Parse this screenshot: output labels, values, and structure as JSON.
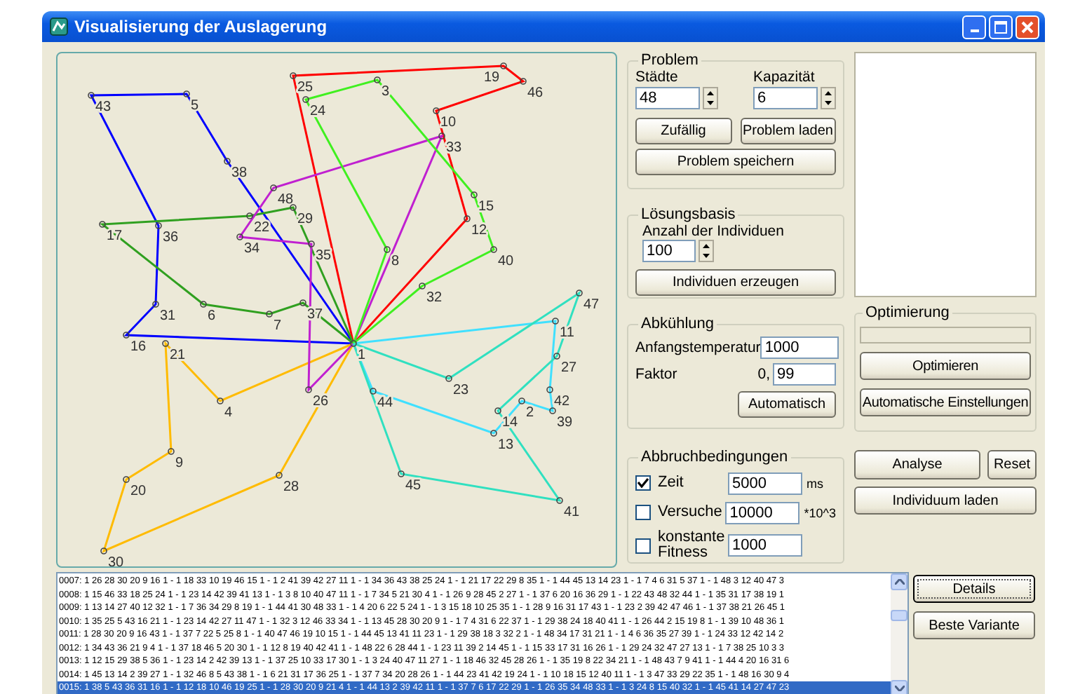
{
  "window": {
    "title": "Visualisierung der Auslagerung"
  },
  "map": {
    "cities": [
      {
        "label": "25"
      },
      {
        "label": "3"
      },
      {
        "label": "19"
      },
      {
        "label": "46"
      },
      {
        "label": "43"
      },
      {
        "label": "5"
      },
      {
        "label": "24"
      },
      {
        "label": "10"
      },
      {
        "label": "33"
      },
      {
        "label": "38"
      },
      {
        "label": "48"
      },
      {
        "label": "15"
      },
      {
        "label": "17"
      },
      {
        "label": "36"
      },
      {
        "label": "22"
      },
      {
        "label": "29"
      },
      {
        "label": "12"
      },
      {
        "label": "34"
      },
      {
        "label": "35"
      },
      {
        "label": "8"
      },
      {
        "label": "40"
      },
      {
        "label": "32"
      },
      {
        "label": "47"
      },
      {
        "label": "31"
      },
      {
        "label": "6"
      },
      {
        "label": "7"
      },
      {
        "label": "37"
      },
      {
        "label": "11"
      },
      {
        "label": "16"
      },
      {
        "label": "21"
      },
      {
        "label": "1"
      },
      {
        "label": "27"
      },
      {
        "label": "4"
      },
      {
        "label": "26"
      },
      {
        "label": "44"
      },
      {
        "label": "23"
      },
      {
        "label": "2"
      },
      {
        "label": "42"
      },
      {
        "label": "14"
      },
      {
        "label": "39"
      },
      {
        "label": "13"
      },
      {
        "label": "9"
      },
      {
        "label": "20"
      },
      {
        "label": "28"
      },
      {
        "label": "45"
      },
      {
        "label": "41"
      },
      {
        "label": "30"
      }
    ],
    "routes": [
      {
        "color": "#0000ff"
      },
      {
        "color": "#ff0000"
      },
      {
        "color": "#ffbb00"
      },
      {
        "color": "#40e0ff"
      },
      {
        "color": "#30a020"
      },
      {
        "color": "#c020d0"
      },
      {
        "color": "#40f020"
      },
      {
        "color": "#30e0c0"
      }
    ]
  },
  "problem": {
    "title": "Problem",
    "cities_label": "Städte",
    "cities_value": "48",
    "capacity_label": "Kapazität",
    "capacity_value": "6",
    "buttons": [
      "Zufällig",
      "Problem laden",
      "Problem speichern"
    ]
  },
  "solution_base": {
    "title": "Lösungsbasis",
    "count_label": "Anzahl der Individuen",
    "count_value": "100",
    "button": "Individuen erzeugen"
  },
  "cooling": {
    "title": "Abkühlung",
    "start_label": "Anfangstemperatur",
    "start_value": "1000",
    "factor_label": "Faktor",
    "factor_prefix": "0,",
    "factor_value": "99",
    "button": "Automatisch"
  },
  "stop": {
    "title": "Abbruchbedingungen",
    "conditions": [
      {
        "label": "Zeit",
        "checked": true,
        "value": "5000",
        "unit": "ms"
      },
      {
        "label": "Versuche",
        "checked": false,
        "value": "10000",
        "unit": "*10^3"
      },
      {
        "label": "konstante Fitness",
        "checked": false,
        "value": "1000"
      }
    ]
  },
  "optimization": {
    "title": "Optimierung",
    "progress": {
      "level": 0
    },
    "buttons": [
      "Optimieren",
      "Automatische Einstellungen"
    ]
  },
  "actions": [
    "Analyse",
    "Reset",
    "Individuum laden"
  ],
  "population": {
    "rows": [
      {
        "text": "0007: 1 26 28 30 20 9 16 1 - 1 18 33 10 19 46 15 1 - 1 2 41 39 42 27 11 1 - 1 34 36 43 38 25 24 1 - 1 21 17 22 29 8 35 1 - 1 44 45 13 14 23 1 - 1 7 4 6 31 5 37 1 - 1 48 3 12 40 47 3",
        "selected": false
      },
      {
        "text": "0008: 1 15 46 33 18 25 24 1 - 1 23 14 42 39 41 13 1 - 1 3 8 10 40 47 11 1 - 1 7 34 5 21 30 4 1 - 1 26 9 28 45 2 27 1 - 1 37 6 20 16 36 29 1 - 1 22 43 48 32 44 1 - 1 35 31 17 38 19 1",
        "selected": false
      },
      {
        "text": "0009: 1 13 14 27 40 12 32 1 - 1 7 36 34 29 8 19 1 - 1 44 41 30 48 33 1 - 1 4 20 6 22 5 24 1 - 1 3 15 18 10 25 35 1 - 1 28 9 16 31 17 43 1 - 1 23 2 39 42 47 46 1 - 1 37 38 21 26 45 1",
        "selected": false
      },
      {
        "text": "0010: 1 35 25 5 43 16 21 1 - 1 23 14 42 27 11 47 1 - 1 32 3 12 46 33 34 1 - 1 13 45 28 30 20 9 1 - 1 7 4 31 6 22 37 1 - 1 29 38 24 18 40 41 1 - 1 26 44 2 15 19 8 1 - 1 39 10 48 36 1",
        "selected": false
      },
      {
        "text": "0011: 1 28 30 20 9 16 43 1 - 1 37 7 22 5 25 8 1 - 1 40 47 46 19 10 15 1 - 1 44 45 13 41 11 23 1 - 1 29 38 18 3 32 2 1 - 1 48 34 17 31 21 1 - 1 4 6 36 35 27 39 1 - 1 24 33 12 42 14 2",
        "selected": false
      },
      {
        "text": "0012: 1 34 43 36 21 9 4 1 - 1 37 18 46 5 20 30 1 - 1 12 8 19 40 42 41 1 - 1 48 22 6 28 44 1 - 1 23 11 39 2 14 45 1 - 1 15 33 17 31 16 26 1 - 1 29 24 32 47 27 13 1 - 1 7 38 25 10 3 3",
        "selected": false
      },
      {
        "text": "0013: 1 12 15 29 38 5 36 1 - 1 23 14 2 42 39 13 1 - 1 37 25 10 33 17 30 1 - 1 3 24 40 47 11 27 1 - 1 18 46 32 45 28 26 1 - 1 35 19 8 22 34 21 1 - 1 48 43 7 9 41 1 - 1 44 4 20 16 31 6",
        "selected": false
      },
      {
        "text": "0014: 1 45 13 14 2 39 27 1 - 1 32 46 8 5 43 38 1 - 1 6 21 31 17 36 25 1 - 1 37 7 34 20 28 26 1 - 1 44 23 41 42 19 24 1 - 1 10 18 15 12 40 11 1 - 1 3 47 33 29 22 35 1 - 1 48 16 30 9 4",
        "selected": false
      },
      {
        "text": "0015: 1 38 5 43 36 31 16 1 - 1 12 18 10 46 19 25 1 - 1 28 30 20 9 21 4 1 - 1 44 13 2 39 42 11 1 - 1 37 7 6 17 22 29 1 - 1 26 35 34 48 33 1 - 1 3 24 8 15 40 32 1 - 1 45 41 14 27 47 23",
        "selected": true
      }
    ]
  },
  "side_buttons": [
    {
      "label": "Details",
      "default": true
    },
    {
      "label": "Beste Variante",
      "default": false
    }
  ]
}
